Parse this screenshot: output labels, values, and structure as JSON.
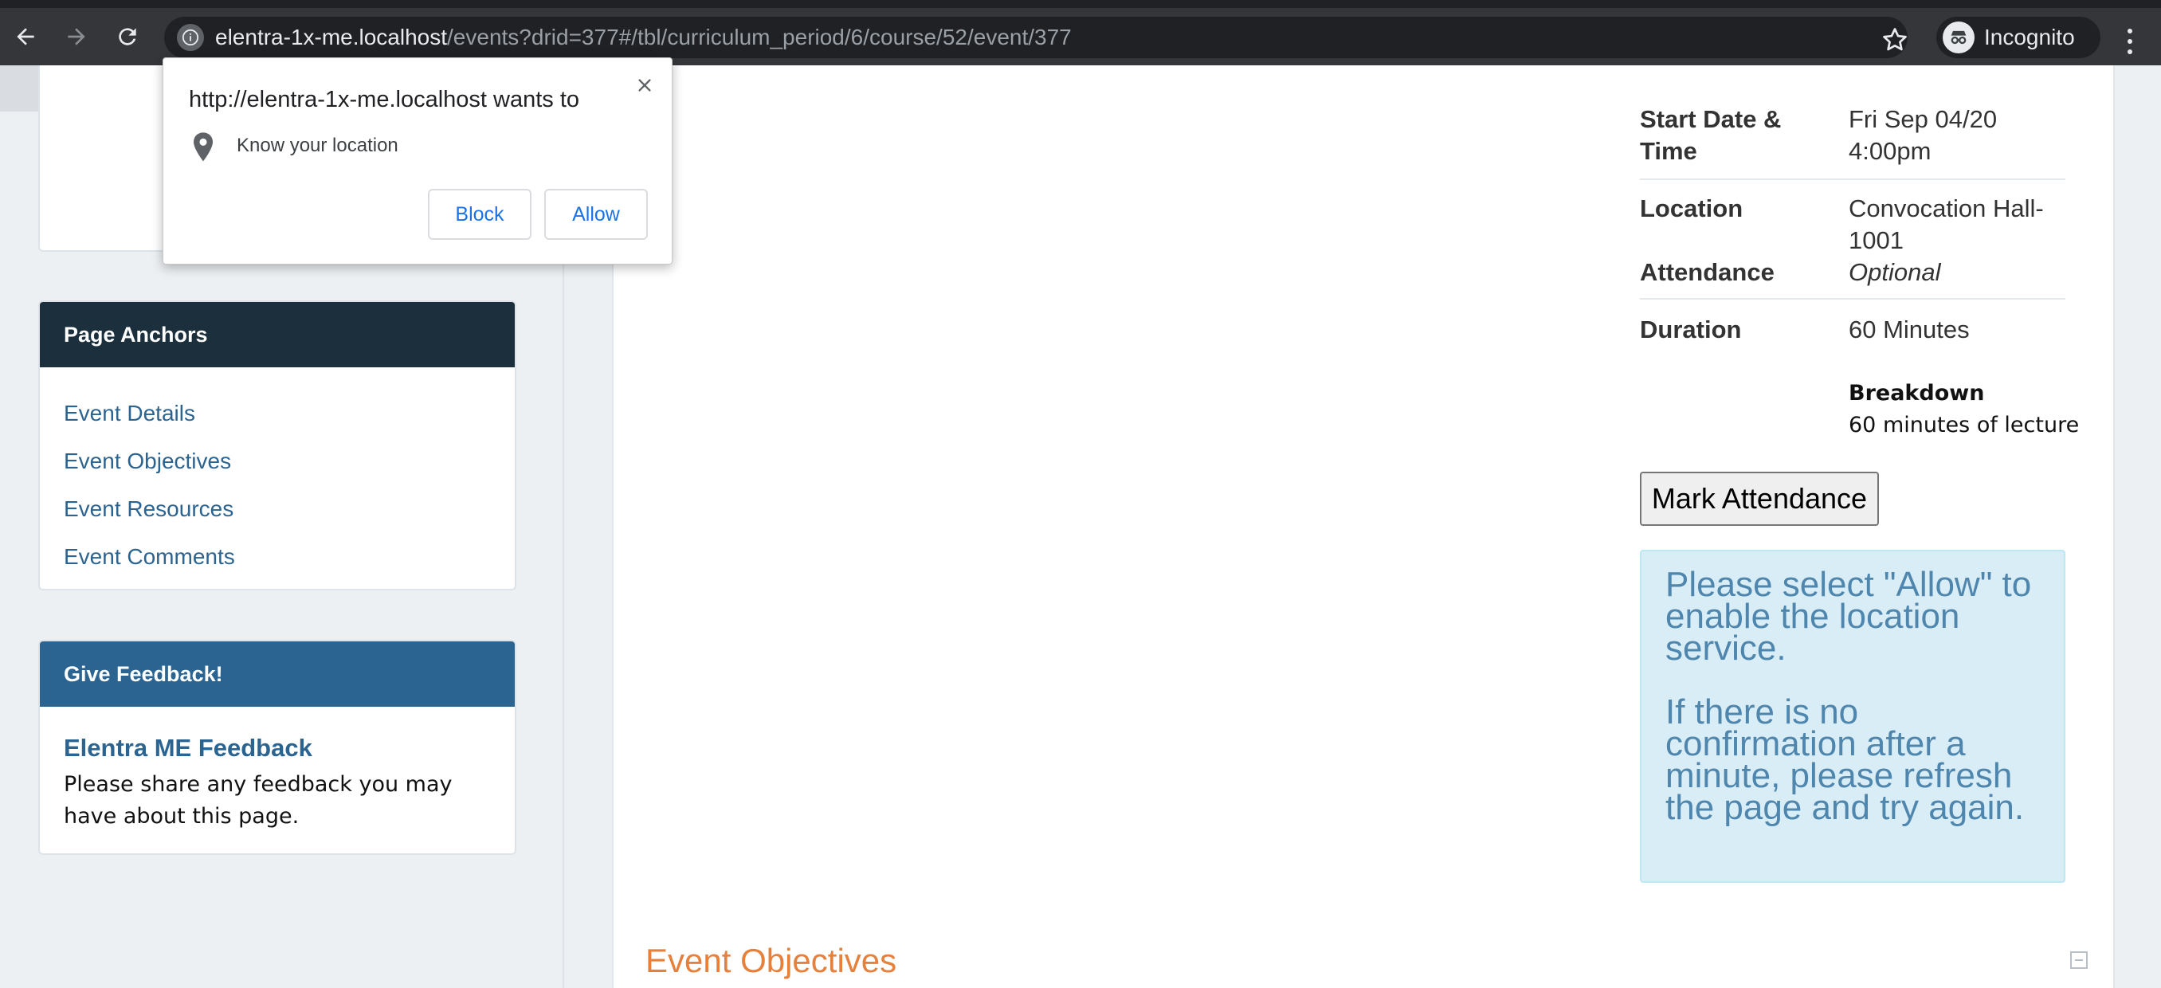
{
  "browser": {
    "url_host": "elentra-1x-me.localhost",
    "url_path": "/events?drid=377#/tbl/curriculum_period/6/course/52/event/377",
    "incognito_label": "Incognito"
  },
  "permission_popup": {
    "title": "http://elentra-1x-me.localhost wants to",
    "permission": "Know your location",
    "block_label": "Block",
    "allow_label": "Allow"
  },
  "sidebar": {
    "anchors": {
      "title": "Page Anchors",
      "links": [
        "Event Details",
        "Event Objectives",
        "Event Resources",
        "Event Comments"
      ]
    },
    "feedback": {
      "title": "Give Feedback!",
      "link": "Elentra ME Feedback",
      "text": "Please share any feedback you may have about this page."
    }
  },
  "event_details": {
    "start_label": "Start Date & Time",
    "start_value_line1": "Fri Sep 04/20",
    "start_value_line2": "4:00pm",
    "location_label": "Location",
    "location_value_line1": "Convocation Hall-",
    "location_value_line2": "1001",
    "attendance_label": "Attendance",
    "attendance_value": "Optional",
    "duration_label": "Duration",
    "duration_value": "60 Minutes",
    "breakdown_label": "Breakdown",
    "breakdown_value": "60 minutes of lecture"
  },
  "mark_attendance_label": "Mark Attendance",
  "location_alert": {
    "line1": "Please select \"Allow\" to enable the location service.",
    "line2": "If there is no confirmation after a minute, please refresh the page and try again."
  },
  "objectives_title": "Event Objectives",
  "colors": {
    "link_blue": "#2b6491",
    "header_dark": "#1c2f3c",
    "section_orange": "#e5813d",
    "alert_bg": "#d9edf7"
  }
}
